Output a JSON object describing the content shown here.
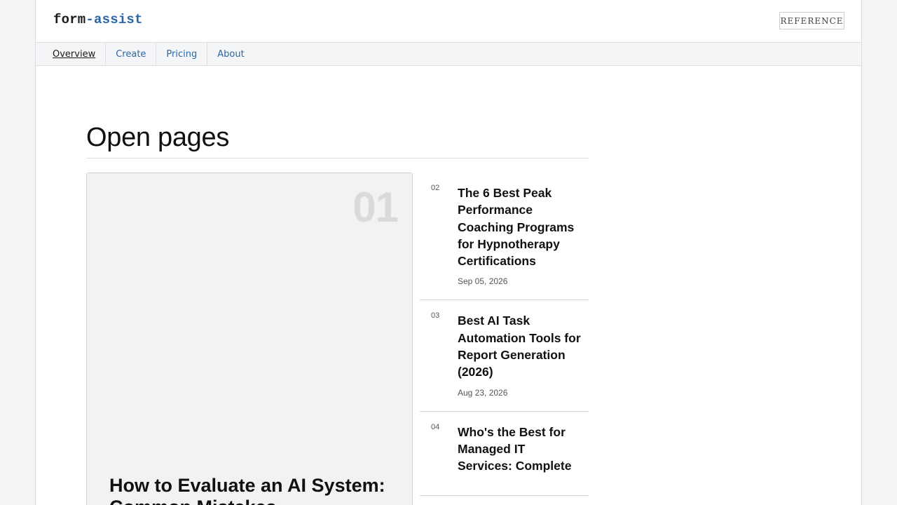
{
  "brand": {
    "logo_part1": "form",
    "logo_part2": "-assist"
  },
  "header": {
    "reference_label": "REFERENCE"
  },
  "nav": {
    "items": [
      {
        "label": "Overview"
      },
      {
        "label": "Create"
      },
      {
        "label": "Pricing"
      },
      {
        "label": "About"
      }
    ]
  },
  "main": {
    "section_title": "Open pages",
    "featured": {
      "number": "01",
      "title": "How to Evaluate an AI System: Common Mistakes"
    },
    "items": [
      {
        "number": "02",
        "title": "The 6 Best Peak Performance Coaching Programs for Hypnotherapy Certifications",
        "date": "Sep 05, 2026"
      },
      {
        "number": "03",
        "title": "Best AI Task Automation Tools for Report Generation (2026)",
        "date": "Aug 23, 2026"
      },
      {
        "number": "04",
        "title": "Who's the Best for Managed IT Services: Complete",
        "date": ""
      }
    ]
  }
}
